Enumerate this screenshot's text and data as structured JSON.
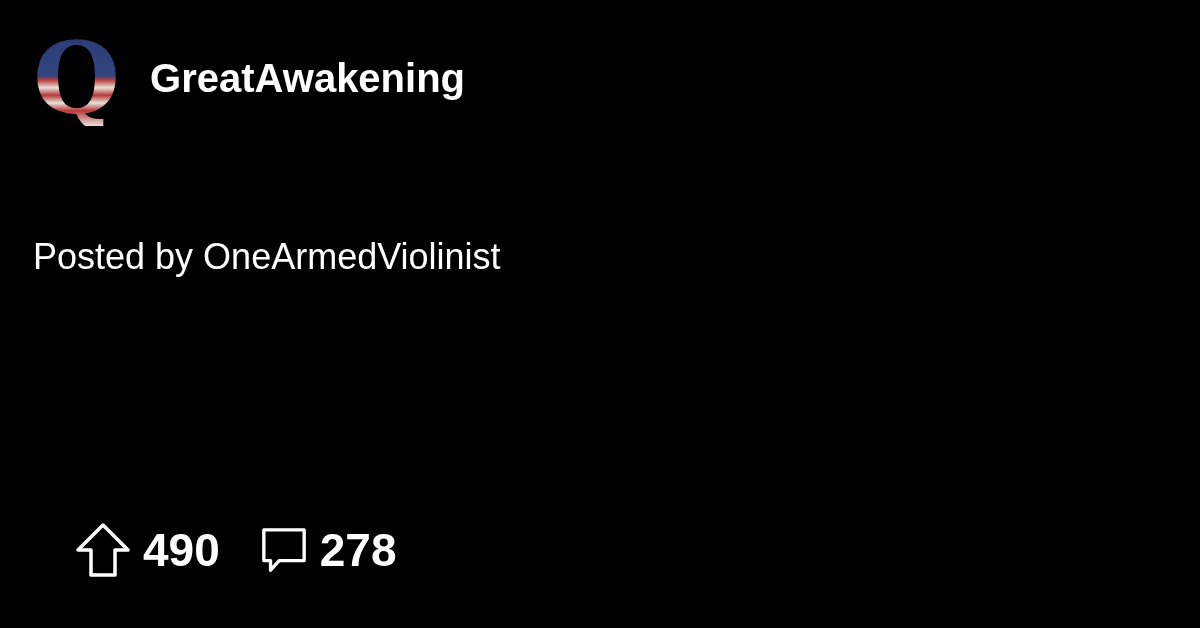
{
  "community": {
    "logo_letter": "Q",
    "name": "GreatAwakening"
  },
  "post": {
    "byline": "Posted by OneArmedViolinist"
  },
  "stats": {
    "upvotes": "490",
    "comments": "278"
  }
}
